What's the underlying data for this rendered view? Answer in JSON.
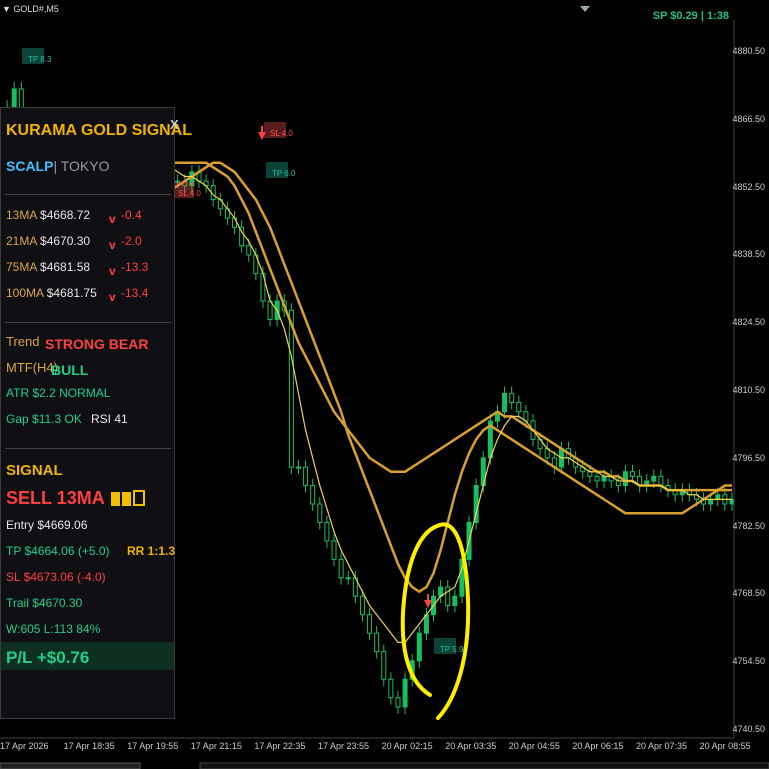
{
  "header": {
    "symbol": "GOLD#,M5",
    "spread": "SP $0.29 | 1:38"
  },
  "panel": {
    "title": "KURAMA GOLD SIGNAL",
    "close": "X",
    "mode_active": "SCALP",
    "mode_inactive": "TOKYO",
    "ma": [
      {
        "label": "13MA",
        "value": "$4668.72",
        "arrow": "v",
        "delta": "-0.4"
      },
      {
        "label": "21MA",
        "value": "$4670.30",
        "arrow": "v",
        "delta": "-2.0"
      },
      {
        "label": "75MA",
        "value": "$4681.58",
        "arrow": "v",
        "delta": "-13.3"
      },
      {
        "label": "100MA",
        "value": "$4681.75",
        "arrow": "v",
        "delta": "-13.4"
      }
    ],
    "trend_label": "Trend",
    "trend_value": "STRONG BEAR",
    "mtf_label": "MTF(H4)",
    "mtf_value": "BULL",
    "atr": "ATR  $2.2  NORMAL",
    "gap": "Gap $11.3 OK",
    "rsi": "RSI 41",
    "signal_label": "SIGNAL",
    "signal_value": "SELL  13MA",
    "entry": "Entry  $4669.06",
    "tp": "TP  $4664.06  (+5.0)",
    "rr": "RR 1:1.3",
    "sl": "SL  $4673.06  (-4.0)",
    "trail": "Trail  $4670.30",
    "winloss": "W:605 L:113  84%",
    "pl": "P/L  +$0.76"
  },
  "chart_data": {
    "type": "line",
    "symbol": "GOLD#",
    "timeframe": "M5",
    "y_ticks": [
      "4880.50",
      "4866.50",
      "4852.50",
      "4838.50",
      "4824.50",
      "4810.50",
      "4796.50",
      "4782.50",
      "4768.50",
      "4754.50",
      "4740.50"
    ],
    "x_ticks": [
      "17 Apr 2026",
      "17 Apr 18:35",
      "17 Apr 19:55",
      "17 Apr 21:15",
      "17 Apr 22:35",
      "17 Apr 23:55",
      "20 Apr 02:15",
      "20 Apr 03:35",
      "20 Apr 04:55",
      "20 Apr 06:15",
      "20 Apr 07:35",
      "20 Apr 08:55"
    ],
    "ylim": [
      4737,
      4884
    ],
    "price": [
      4868,
      4872,
      4876,
      4870,
      4866,
      4862,
      4858,
      4860,
      4862,
      4858,
      4856,
      4858,
      4860,
      4858,
      4856,
      4855,
      4857,
      4858,
      4860,
      4862,
      4864,
      4862,
      4860,
      4858,
      4856,
      4856,
      4855,
      4858,
      4856,
      4855,
      4852,
      4850,
      4848,
      4846,
      4842,
      4840,
      4836,
      4830,
      4826,
      4830,
      4828,
      4794,
      4794,
      4790,
      4786,
      4782,
      4778,
      4774,
      4770,
      4770,
      4766,
      4762,
      4758,
      4754,
      4748,
      4744,
      4742,
      4748,
      4752,
      4758,
      4762,
      4766,
      4768,
      4764,
      4766,
      4774,
      4782,
      4790,
      4796,
      4804,
      4806,
      4810,
      4808,
      4806,
      4804,
      4800,
      4798,
      4796,
      4794,
      4798,
      4796,
      4794,
      4793,
      4792,
      4791,
      4792,
      4791,
      4790,
      4793,
      4792,
      4790,
      4791,
      4792,
      4790,
      4789,
      4788,
      4789,
      4788,
      4787,
      4786,
      4787,
      4788,
      4786,
      4787
    ],
    "ma13": [
      4866,
      4864,
      4862,
      4861,
      4860,
      4858,
      4857,
      4857,
      4857,
      4857,
      4856,
      4856,
      4858,
      4858,
      4857,
      4856,
      4856,
      4856,
      4858,
      4860,
      4862,
      4862,
      4861,
      4860,
      4859,
      4858,
      4857,
      4857,
      4856,
      4855,
      4853,
      4852,
      4850,
      4848,
      4845,
      4843,
      4840,
      4836,
      4830,
      4828,
      4824,
      4818,
      4810,
      4802,
      4796,
      4790,
      4785,
      4780,
      4776,
      4773,
      4770,
      4767,
      4764,
      4762,
      4760,
      4758,
      4756,
      4756,
      4758,
      4760,
      4762,
      4764,
      4766,
      4767,
      4768,
      4772,
      4778,
      4784,
      4790,
      4796,
      4800,
      4803,
      4805,
      4805,
      4804,
      4802,
      4800,
      4798,
      4797,
      4796,
      4796,
      4795,
      4794,
      4793,
      4793,
      4792,
      4792,
      4791,
      4791,
      4791,
      4790,
      4790,
      4790,
      4790,
      4789,
      4789,
      4789,
      4788,
      4788,
      4787,
      4787,
      4787,
      4787,
      4787
    ],
    "ma75": [
      4840,
      4840,
      4840,
      4840,
      4840,
      4840,
      4840,
      4840,
      4840,
      4840,
      4840,
      4840,
      4840,
      4840,
      4841,
      4842,
      4843,
      4844,
      4845,
      4846,
      4848,
      4849,
      4850,
      4852,
      4854,
      4855,
      4856,
      4857,
      4858,
      4859,
      4860,
      4860,
      4859,
      4858,
      4856,
      4854,
      4852,
      4849,
      4846,
      4842,
      4838,
      4834,
      4830,
      4826,
      4822,
      4818,
      4814,
      4810,
      4806,
      4801,
      4797,
      4793,
      4789,
      4785,
      4781,
      4777,
      4773,
      4770,
      4768,
      4767,
      4768,
      4771,
      4776,
      4782,
      4788,
      4793,
      4797,
      4800,
      4802,
      4803,
      4802,
      4801,
      4800,
      4799,
      4798,
      4797,
      4796,
      4795,
      4794,
      4793,
      4792,
      4791,
      4790,
      4789,
      4788,
      4787,
      4786,
      4785,
      4784,
      4784,
      4784,
      4784,
      4784,
      4784,
      4784,
      4784,
      4784,
      4785,
      4786,
      4787,
      4788,
      4789,
      4790,
      4790
    ],
    "ma100": [
      4866,
      4866,
      4865,
      4865,
      4864,
      4864,
      4863,
      4863,
      4862,
      4862,
      4862,
      4861,
      4861,
      4861,
      4860,
      4860,
      4860,
      4860,
      4860,
      4860,
      4860,
      4860,
      4860,
      4860,
      4860,
      4860,
      4860,
      4860,
      4860,
      4860,
      4859,
      4858,
      4857,
      4855,
      4852,
      4849,
      4845,
      4841,
      4837,
      4833,
      4829,
      4825,
      4821,
      4818,
      4815,
      4812,
      4809,
      4806,
      4804,
      4802,
      4800,
      4798,
      4796,
      4795,
      4794,
      4793,
      4793,
      4793,
      4794,
      4795,
      4796,
      4797,
      4798,
      4799,
      4800,
      4801,
      4802,
      4803,
      4804,
      4805,
      4806,
      4805,
      4805,
      4804,
      4803,
      4802,
      4801,
      4800,
      4799,
      4798,
      4797,
      4796,
      4795,
      4794,
      4793,
      4793,
      4792,
      4792,
      4791,
      4791,
      4790,
      4790,
      4790,
      4790,
      4789,
      4789,
      4789,
      4789,
      4789,
      4789,
      4789,
      4789,
      4789,
      4789
    ],
    "annotations": [
      {
        "text": "TP 8.3",
        "color": "#20c0a0"
      },
      {
        "text": "SL 4.0",
        "color": "#ff5050"
      },
      {
        "text": "TP 6.0",
        "color": "#20c0a0"
      },
      {
        "text": "SL 4.0",
        "color": "#ff5050"
      },
      {
        "text": "TP 5.9",
        "color": "#20c0a0"
      }
    ]
  },
  "colors": {
    "background": "#000000",
    "candle": "#16c060",
    "ma_fast": "#f5d24a",
    "ma_slow": "#d9a030",
    "highlight": "#ffee00"
  }
}
